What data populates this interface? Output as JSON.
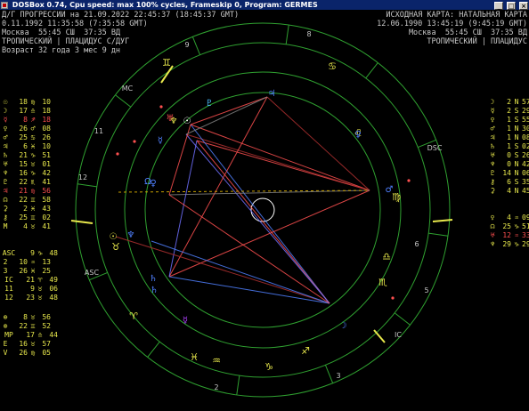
{
  "window": {
    "title": "DOSBox 0.74, Cpu speed: max 100% cycles, Frameskip  0, Program:   GERMES",
    "controls": [
      "_",
      "□",
      "×"
    ]
  },
  "header_left": [
    "Д/Г ПРОГРЕССИИ на 21.09.2022 22:45:37 (18:45:37 GMT)",
    "0.11.1992 11:35:58 (7:35:58 GMT)",
    "Москва  55:45 СШ  37:35 ВД",
    "ТРОПИЧЕСКИЙ | ПЛАЦИДУС С/ДУГ",
    "Возраст 32 года 3 мес 9 дн"
  ],
  "header_right": [
    "ИСХОДНАЯ КАРТА: НАТАЛЬНАЯ КАРТА",
    "12.06.1990 13:45:19 (9:45:19 GMT)",
    "Москва  55:45 СШ  37:35 ВД",
    "ТРОПИЧЕСКИЙ | ПЛАЦИДУС"
  ],
  "left_table": [
    {
      "glyph": "☉",
      "n1": "18",
      "sign": "♍",
      "n2": "10",
      "color": "#e8e84c"
    },
    {
      "glyph": "☽",
      "n1": "17",
      "sign": "♎",
      "n2": "18",
      "color": "#e8e84c"
    },
    {
      "glyph": "☿",
      "n1": "8",
      "sign": "♐",
      "n2": "18",
      "color": "#ff5050"
    },
    {
      "glyph": "♀",
      "n1": "26",
      "sign": "♂",
      "n2": "08",
      "color": "#e8e84c"
    },
    {
      "glyph": "♂",
      "n1": "25",
      "sign": "♋",
      "n2": "26",
      "color": "#e8e84c"
    },
    {
      "glyph": "♃",
      "n1": "6",
      "sign": "♓",
      "n2": "10",
      "color": "#e8e84c"
    },
    {
      "glyph": "♄",
      "n1": "21",
      "sign": "♑",
      "n2": "51",
      "color": "#e8e84c"
    },
    {
      "glyph": "♅",
      "n1": "15",
      "sign": "♉",
      "n2": "01",
      "color": "#e8e84c"
    },
    {
      "glyph": "♆",
      "n1": "16",
      "sign": "♑",
      "n2": "42",
      "color": "#e8e84c"
    },
    {
      "glyph": "♇",
      "n1": "22",
      "sign": "♏",
      "n2": "41",
      "color": "#e8e84c"
    },
    {
      "glyph": "♃",
      "n1": "21",
      "sign": "♍",
      "n2": "56",
      "color": "#ff5050"
    },
    {
      "glyph": "☊",
      "n1": "22",
      "sign": "♊",
      "n2": "58",
      "color": "#e8e84c"
    },
    {
      "glyph": "⚳",
      "n1": "2",
      "sign": "♓",
      "n2": "43",
      "color": "#e8e84c"
    },
    {
      "glyph": "⚷",
      "n1": "25",
      "sign": "♊",
      "n2": "02",
      "color": "#e8e84c"
    },
    {
      "glyph": "M",
      "n1": "4",
      "sign": "♉",
      "n2": "41",
      "color": "#e8e84c"
    }
  ],
  "left_houses": [
    {
      "label": "ASC",
      "n1": "9",
      "sign": "♑",
      "n2": "48",
      "color": "#e8e84c"
    },
    {
      "label": "2",
      "n1": "10",
      "sign": "♒",
      "n2": "13",
      "color": "#e8e84c"
    },
    {
      "label": "3",
      "n1": "26",
      "sign": "♓",
      "n2": "25",
      "color": "#e8e84c"
    },
    {
      "label": "IC",
      "n1": "21",
      "sign": "♈",
      "n2": "49",
      "color": "#e8e84c"
    },
    {
      "label": "11",
      "n1": "9",
      "sign": "♉",
      "n2": "06",
      "color": "#e8e84c"
    },
    {
      "label": "12",
      "n1": "23",
      "sign": "♉",
      "n2": "48",
      "color": "#e8e84c"
    }
  ],
  "left_extra": [
    {
      "glyph": "⊕",
      "n1": "8",
      "sign": "♉",
      "n2": "56",
      "color": "#e8e84c"
    },
    {
      "glyph": "⊗",
      "n1": "22",
      "sign": "♊",
      "n2": "52",
      "color": "#e8e84c"
    },
    {
      "glyph": "MP",
      "n1": "17",
      "sign": "♎",
      "n2": "44",
      "color": "#e8e84c"
    },
    {
      "glyph": "E",
      "n1": "16",
      "sign": "♉",
      "n2": "57",
      "color": "#e8e84c"
    },
    {
      "glyph": "V",
      "n1": "26",
      "sign": "♍",
      "n2": "05",
      "color": "#e8e84c"
    }
  ],
  "right_table": [
    {
      "glyph": "☽",
      "n1": "2",
      "sign": "N",
      "n2": "57",
      "color": "#e8e84c"
    },
    {
      "glyph": "☿",
      "n1": "2",
      "sign": "S",
      "n2": "29",
      "color": "#e8e84c"
    },
    {
      "glyph": "♀",
      "n1": "1",
      "sign": "S",
      "n2": "55",
      "color": "#e8e84c"
    },
    {
      "glyph": "♂",
      "n1": "1",
      "sign": "N",
      "n2": "30",
      "color": "#e8e84c"
    },
    {
      "glyph": "♃",
      "n1": "1",
      "sign": "N",
      "n2": "08",
      "color": "#e8e84c"
    },
    {
      "glyph": "♄",
      "n1": "1",
      "sign": "S",
      "n2": "02",
      "color": "#e8e84c"
    },
    {
      "glyph": "♅",
      "n1": "0",
      "sign": "S",
      "n2": "26",
      "color": "#e8e84c"
    },
    {
      "glyph": "♆",
      "n1": "0",
      "sign": "N",
      "n2": "42",
      "color": "#e8e84c"
    },
    {
      "glyph": "♇",
      "n1": "14",
      "sign": "N",
      "n2": "06",
      "color": "#e8e84c"
    },
    {
      "glyph": "⚷",
      "n1": "6",
      "sign": "S",
      "n2": "35",
      "color": "#e8e84c"
    },
    {
      "glyph": "⚳",
      "n1": "4",
      "sign": "N",
      "n2": "45",
      "color": "#e8e84c"
    }
  ],
  "right_extra": [
    {
      "glyph": "♀",
      "n1": "4",
      "sign": "♒",
      "n2": "09",
      "color": "#e8e84c"
    },
    {
      "glyph": "☊",
      "n1": "25",
      "sign": "♑",
      "n2": "51",
      "color": "#e8e84c"
    },
    {
      "glyph": "♅",
      "n1": "12",
      "sign": "♒",
      "n2": "33",
      "color": "#ff5050"
    },
    {
      "glyph": "♆",
      "n1": "29",
      "sign": "♑",
      "n2": "29",
      "color": "#e8e84c"
    }
  ],
  "house_numbers": [
    "9",
    "8",
    "MC",
    "11",
    "12",
    "DSC",
    "ASC",
    "6",
    "5",
    "IC",
    "3",
    "2"
  ],
  "zodiac_signs": [
    "♋",
    "♌",
    "♍",
    "♎",
    "♏",
    "♐",
    "♑",
    "♒",
    "♓",
    "♈",
    "♉",
    "♊"
  ],
  "wheel_planets": [
    {
      "glyph": "♃",
      "color": "#5080ff"
    },
    {
      "glyph": "♅",
      "color": "#ff5050"
    },
    {
      "glyph": "♇",
      "color": "#4cc0ff"
    },
    {
      "glyph": "♆",
      "color": "#e8e84c"
    },
    {
      "glyph": "☉",
      "color": "#ffffff"
    },
    {
      "glyph": "☿",
      "color": "#5080ff"
    },
    {
      "glyph": "Ω",
      "color": "#5080ff"
    },
    {
      "glyph": "♀",
      "color": "#5080ff"
    },
    {
      "glyph": "♆",
      "color": "#5080ff"
    },
    {
      "glyph": "☉",
      "color": "#e8e84c"
    },
    {
      "glyph": "♄",
      "color": "#5080ff"
    },
    {
      "glyph": "☿",
      "color": "#b040ff"
    },
    {
      "glyph": "☽",
      "color": "#5080ff"
    },
    {
      "glyph": "♀",
      "color": "#5080ff"
    },
    {
      "glyph": "♂",
      "color": "#5080ff"
    },
    {
      "glyph": "♄",
      "color": "#5080ff"
    }
  ],
  "colors": {
    "text": "#c8c8c8",
    "yellow": "#e8e84c",
    "red": "#ff5050",
    "blue": "#5080ff",
    "green": "#2fa030",
    "white": "#ffffff",
    "background": "#000000"
  }
}
